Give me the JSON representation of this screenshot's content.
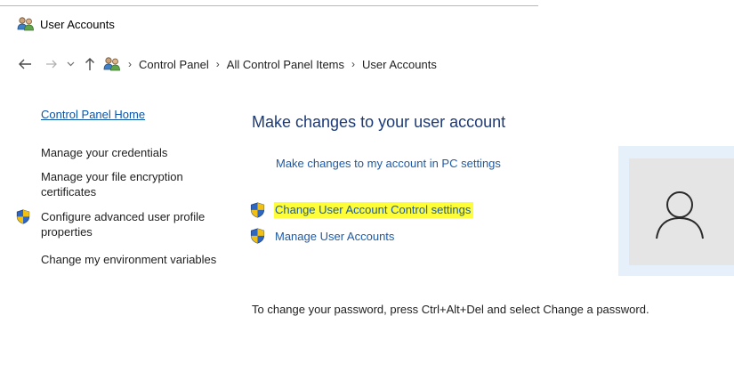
{
  "window": {
    "title": "User Accounts",
    "title_icon": "users-icon"
  },
  "nav": {
    "back_icon": "back-arrow-icon",
    "forward_icon": "forward-arrow-icon",
    "recent_icon": "chevron-down-icon",
    "up_icon": "up-arrow-icon",
    "breadcrumb_icon": "users-icon",
    "separator": "›",
    "breadcrumb": [
      "Control Panel",
      "All Control Panel Items",
      "User Accounts"
    ]
  },
  "sidebar": {
    "home_link": "Control Panel Home",
    "items": [
      "Manage your credentials",
      "Manage your file encryption certificates",
      "Configure advanced user profile properties",
      "Change my environment variables"
    ],
    "shield_icon": "uac-shield-icon"
  },
  "main": {
    "heading": "Make changes to your user account",
    "pc_settings_link": "Make changes to my account in PC settings",
    "tasks": [
      {
        "label": "Change User Account Control settings",
        "icon": "uac-shield-icon",
        "highlight_color": "#fdfd3a"
      },
      {
        "label": "Manage User Accounts",
        "icon": "uac-shield-icon"
      }
    ],
    "avatar_icon": "user-avatar-icon",
    "password_note": "To change your password, press Ctrl+Alt+Del and select Change a password."
  },
  "colors": {
    "link": "#1e5aa6",
    "heading": "#1c3a78",
    "highlight": "#fdfd3a",
    "avatar_tile": "#e5e5e5",
    "avatar_frame": "#e6f0fa"
  }
}
